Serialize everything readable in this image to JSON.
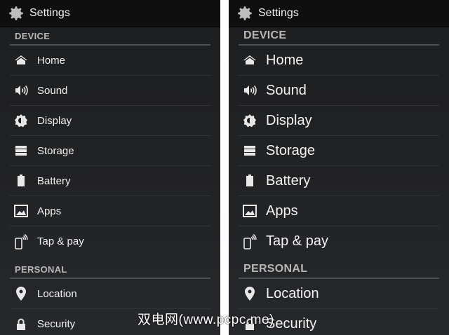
{
  "app": {
    "title": "Settings"
  },
  "sections": {
    "device": "DEVICE",
    "personal": "PERSONAL"
  },
  "items": {
    "home": "Home",
    "sound": "Sound",
    "display": "Display",
    "storage": "Storage",
    "battery": "Battery",
    "apps": "Apps",
    "tap_pay": "Tap & pay",
    "location": "Location",
    "security": "Security"
  },
  "watermark": "双电网(www.pcpc.me)",
  "colors": {
    "background": "#222325",
    "text": "#f2f2f2",
    "section": "#b8b8b8",
    "divider": "#4b4f53"
  }
}
